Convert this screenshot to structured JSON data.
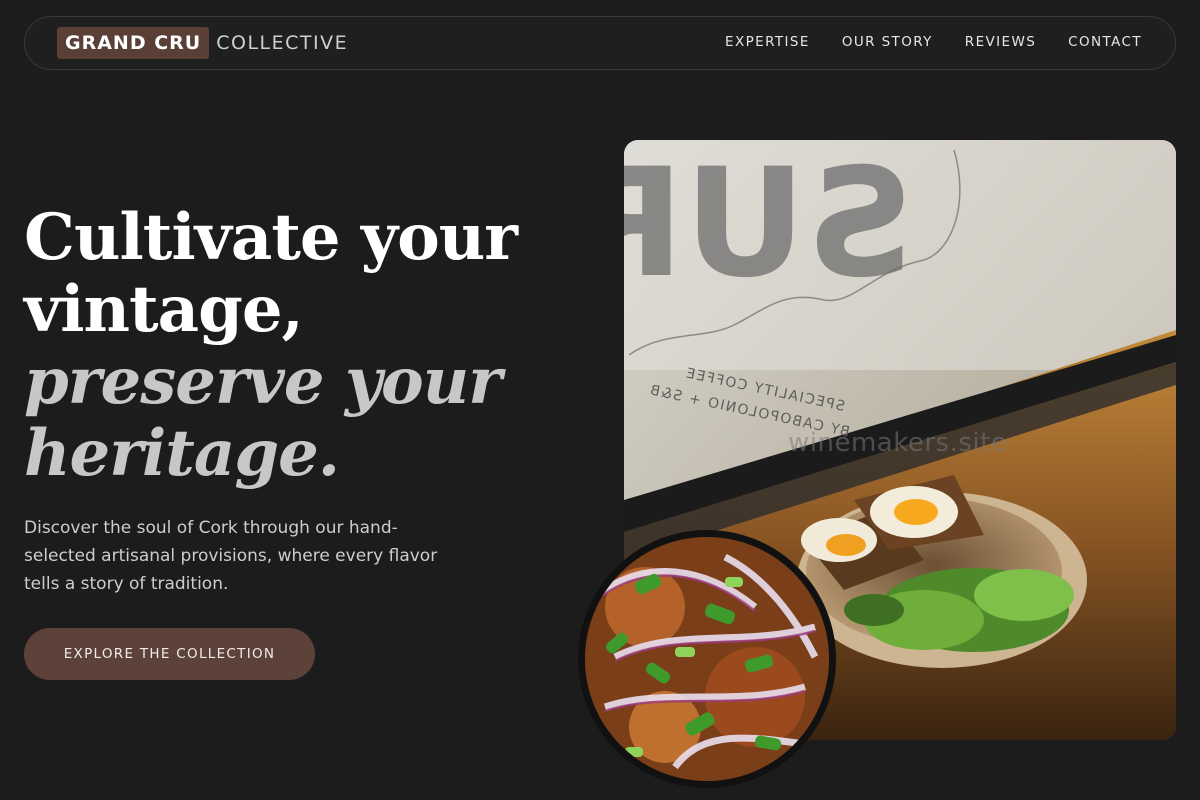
{
  "nav": {
    "brand_primary": "GRAND CRU",
    "brand_secondary": "COLLECTIVE",
    "links": [
      {
        "label": "EXPERTISE"
      },
      {
        "label": "OUR STORY"
      },
      {
        "label": "REVIEWS"
      },
      {
        "label": "CONTACT"
      }
    ]
  },
  "hero": {
    "headline": {
      "line1": "Cultivate your",
      "line2": "vintage,",
      "line3": "preserve your",
      "line4": "heritage."
    },
    "lead": "Discover the soul of Cork through our hand-selected artisanal provisions, where every flavor tells a story of tradition.",
    "cta_label": "EXPLORE THE COLLECTION"
  },
  "images": {
    "main_photo": {
      "window_text_large": "SUR",
      "window_text_line1": "SPECIALITY COFFEE",
      "window_text_line2": "BY CABOPOLONIO + S&B"
    },
    "watermark": "winemakers.site"
  },
  "colors": {
    "background": "#1c1c1c",
    "accent_brown": "#5d4239",
    "text_primary": "#ffffff",
    "text_muted": "#c7c7c7"
  }
}
